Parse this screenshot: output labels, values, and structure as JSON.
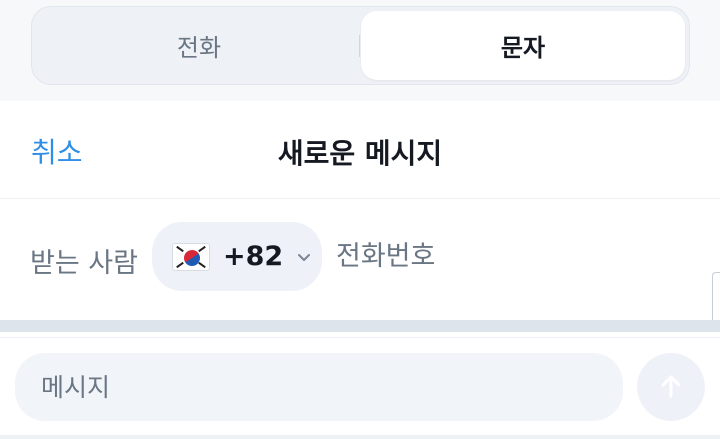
{
  "tabs": {
    "call_label": "전화",
    "sms_label": "문자",
    "selected": "sms"
  },
  "header": {
    "cancel_label": "취소",
    "title": "새로운 메시지"
  },
  "recipient": {
    "label": "받는 사람",
    "country_flag": "south-korea-flag",
    "country_code": "+82",
    "phone_placeholder": "전화번호",
    "phone_value": ""
  },
  "composer": {
    "message_placeholder": "메시지",
    "message_value": "",
    "send_icon": "arrow-up-icon"
  },
  "colors": {
    "accent": "#2f8ee6",
    "text_primary": "#151a22",
    "text_secondary": "#6a7684",
    "chip_background": "#eef2f8"
  }
}
